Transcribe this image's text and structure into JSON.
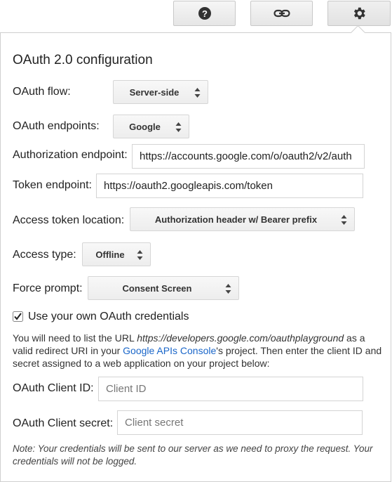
{
  "toolbar": {
    "buttons": [
      {
        "name": "help-button",
        "icon": "question-circle-icon"
      },
      {
        "name": "link-button",
        "icon": "link-icon"
      },
      {
        "name": "settings-button",
        "icon": "gear-icon"
      }
    ]
  },
  "panel": {
    "title": "OAuth 2.0 configuration",
    "oauth_flow": {
      "label": "OAuth flow:",
      "value": "Server-side"
    },
    "oauth_endpoints": {
      "label": "OAuth endpoints:",
      "value": "Google"
    },
    "authorization_endpoint": {
      "label": "Authorization endpoint:",
      "value": "https://accounts.google.com/o/oauth2/v2/auth"
    },
    "token_endpoint": {
      "label": "Token endpoint:",
      "value": "https://oauth2.googleapis.com/token"
    },
    "access_token_location": {
      "label": "Access token location:",
      "value": "Authorization header w/ Bearer prefix"
    },
    "access_type": {
      "label": "Access type:",
      "value": "Offline"
    },
    "force_prompt": {
      "label": "Force prompt:",
      "value": "Consent Screen"
    },
    "own_credentials": {
      "label": "Use your own OAuth credentials",
      "checked": true
    },
    "info": {
      "part1": "You will need to list the URL ",
      "url": "https://developers.google.com/oauthplayground",
      "part2": " as a valid redirect URI in your ",
      "link": "Google APIs Console",
      "part3": "'s project. Then enter the client ID and secret assigned to a web application on your project below:"
    },
    "client_id": {
      "label": "OAuth Client ID:",
      "placeholder": "Client ID"
    },
    "client_secret": {
      "label": "OAuth Client secret:",
      "placeholder": "Client secret"
    },
    "note": "Note: Your credentials will be sent to our server as we need to proxy the request. Your credentials will not be logged."
  },
  "colors": {
    "link": "#1a66c9",
    "border": "#cfcfcf",
    "button_bg": "#eeeeee"
  }
}
